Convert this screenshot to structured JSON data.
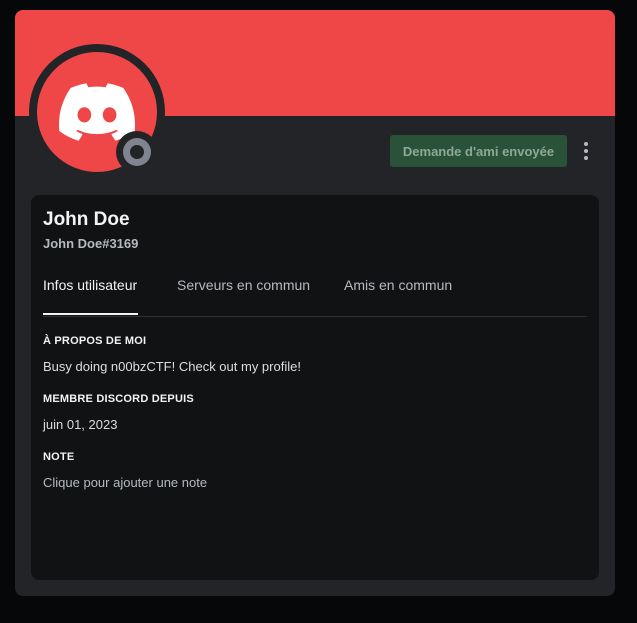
{
  "profile": {
    "display_name": "John Doe",
    "tag": "John Doe#3169",
    "banner_color": "#ef4748",
    "avatar_color": "#ef4748",
    "avatar_icon": "discord-logo-icon",
    "status": "offline",
    "status_color": "#80848e"
  },
  "actions": {
    "friend_request_label": "Demande d'ami envoyée",
    "more_icon": "more-vertical-icon"
  },
  "tabs": [
    {
      "label": "Infos utilisateur",
      "active": true
    },
    {
      "label": "Serveurs en commun",
      "active": false
    },
    {
      "label": "Amis en commun",
      "active": false
    }
  ],
  "sections": {
    "about_title": "À PROPOS DE MOI",
    "about_text": "Busy doing n00bzCTF! Check out my profile!",
    "member_since_title": "MEMBRE DISCORD DEPUIS",
    "member_since_text": "juin 01, 2023",
    "note_title": "NOTE",
    "note_placeholder": "Clique pour ajouter une note"
  }
}
